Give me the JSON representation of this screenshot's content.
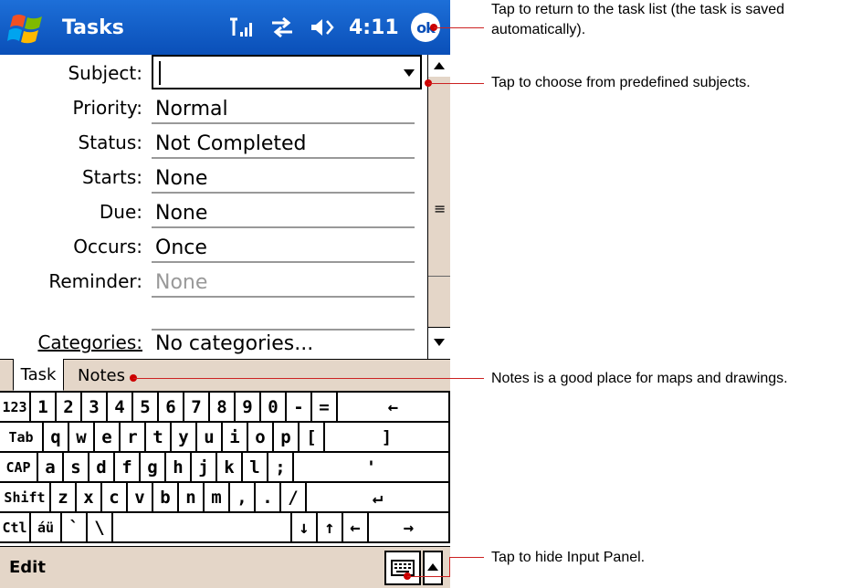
{
  "titlebar": {
    "title": "Tasks",
    "time": "4:11",
    "ok_label": "ok",
    "icons": [
      "windows-start-logo",
      "signal-strength-icon",
      "connectivity-icon",
      "volume-icon"
    ]
  },
  "form": {
    "fields": [
      {
        "label": "Subject:",
        "value": ""
      },
      {
        "label": "Priority:",
        "value": "Normal"
      },
      {
        "label": "Status:",
        "value": "Not Completed"
      },
      {
        "label": "Starts:",
        "value": "None"
      },
      {
        "label": "Due:",
        "value": "None"
      },
      {
        "label": "Occurs:",
        "value": "Once"
      },
      {
        "label": "Reminder:",
        "value": "None"
      },
      {
        "label": "",
        "value": ""
      },
      {
        "label": "Categories:",
        "value": "No categories..."
      }
    ]
  },
  "scrollbar": {
    "grip": "≡"
  },
  "tabs": [
    {
      "label": "Task",
      "active": true
    },
    {
      "label": "Notes",
      "active": false
    }
  ],
  "keyboard": {
    "row1": [
      "123",
      "1",
      "2",
      "3",
      "4",
      "5",
      "6",
      "7",
      "8",
      "9",
      "0",
      "-",
      "=",
      "←"
    ],
    "row2": [
      "Tab",
      "q",
      "w",
      "e",
      "r",
      "t",
      "y",
      "u",
      "i",
      "o",
      "p",
      "[",
      "]"
    ],
    "row3": [
      "CAP",
      "a",
      "s",
      "d",
      "f",
      "g",
      "h",
      "j",
      "k",
      "l",
      ";",
      "'"
    ],
    "row4": [
      "Shift",
      "z",
      "x",
      "c",
      "v",
      "b",
      "n",
      "m",
      ",",
      ".",
      "/",
      "↵"
    ],
    "row5": [
      "Ctl",
      "áü",
      "`",
      "\\",
      "",
      "↓",
      "↑",
      "←",
      "→"
    ]
  },
  "menubar": {
    "edit_label": "Edit"
  },
  "callouts": [
    "Tap to return to the task list (the task is saved automatically).",
    "Tap to choose from predefined subjects.",
    "Notes is a good place for maps and drawings.",
    "Tap to hide Input Panel."
  ],
  "colors": {
    "titlebar": "#0a4fb8",
    "chrome": "#e4d6c8",
    "callout_line": "#cc2222"
  }
}
